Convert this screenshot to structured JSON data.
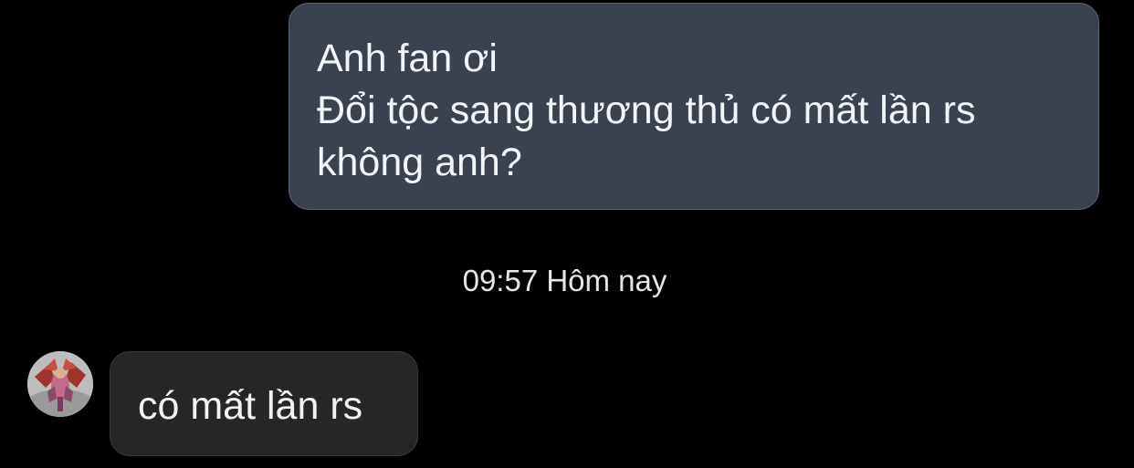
{
  "conversation": {
    "outgoing_message": {
      "lines": [
        "Anh fan ơi",
        "Đổi tộc sang thương thủ có mất lần rs",
        "không anh?"
      ]
    },
    "timestamp": "09:57 Hôm nay",
    "incoming_message": {
      "avatar_icon": "profile-avatar",
      "text": "có mất lần rs"
    }
  },
  "colors": {
    "background": "#000000",
    "outgoing_bubble": "#3a4250",
    "incoming_bubble": "#262626",
    "text": "#ffffff"
  }
}
